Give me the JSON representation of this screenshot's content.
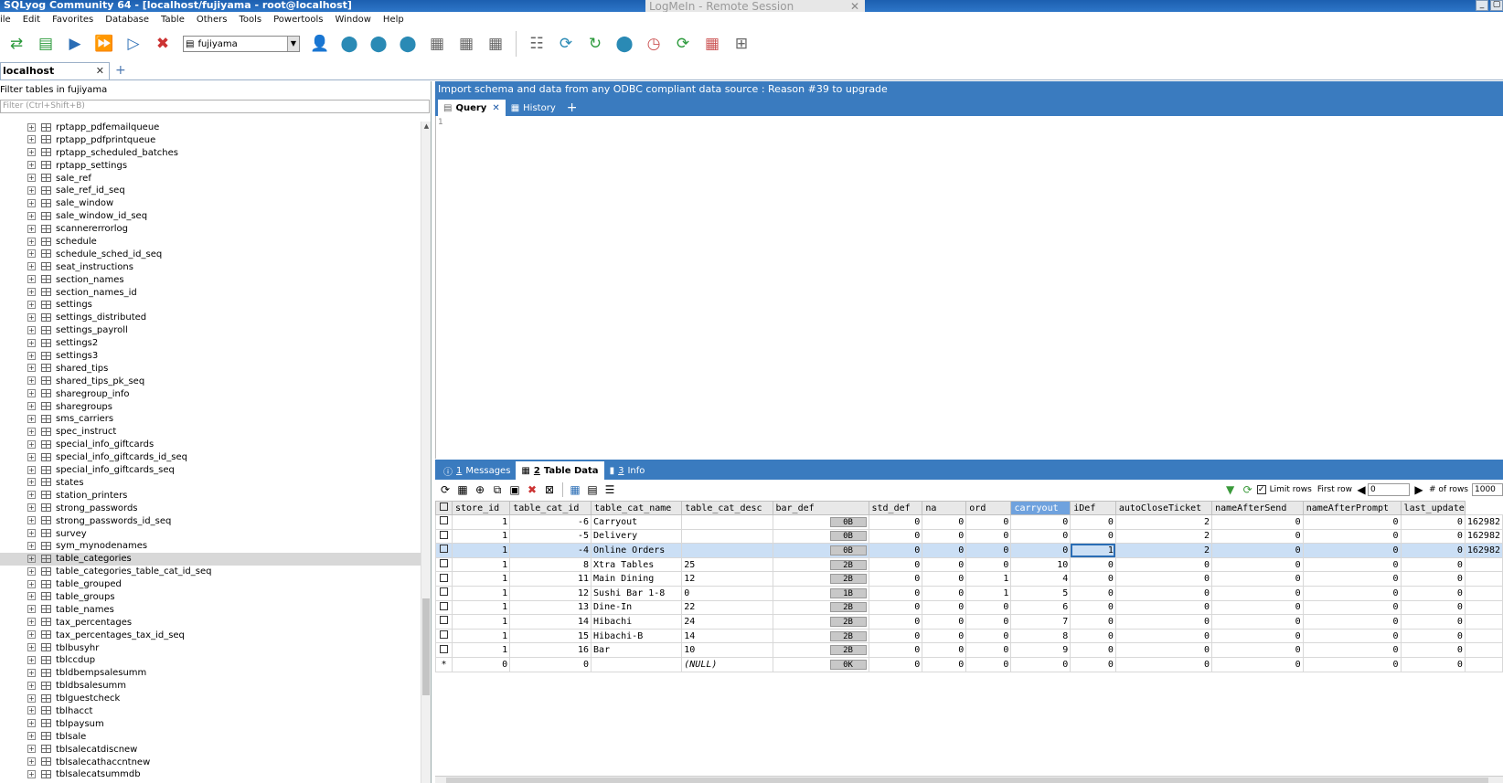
{
  "titlebar": {
    "title": "SQLyog Community 64 - [localhost/fujiyama - root@localhost]"
  },
  "overlay": {
    "text": "LogMeIn - Remote Session",
    "close": "✕"
  },
  "window_buttons": [
    "_",
    "▢"
  ],
  "menu": [
    "ile",
    "Edit",
    "Favorites",
    "Database",
    "Table",
    "Others",
    "Tools",
    "Powertools",
    "Window",
    "Help"
  ],
  "toolbar": {
    "icons": [
      "connect-icon",
      "new-query-icon",
      "execute-icon",
      "execute-all-icon",
      "execute-current-icon",
      "stop-icon"
    ],
    "glyphs": [
      "⇄",
      "▤",
      "▶",
      "⏩",
      "▷",
      "✖"
    ],
    "db_selected": "fujiyama",
    "right_glyphs": [
      "👤",
      "⬤",
      "⬤",
      "⬤",
      "▦",
      "▦",
      "▦",
      "☷",
      "⟳",
      "↻",
      "⬤",
      "◷",
      "⟳",
      "▦",
      "⊞"
    ]
  },
  "connection_tab": {
    "label": "localhost",
    "close": "✕",
    "add": "+"
  },
  "left": {
    "filter_label": "Filter tables in fujiyama",
    "filter_placeholder": "Filter (Ctrl+Shift+B)",
    "tables": [
      "rptapp_pdfemailqueue",
      "rptapp_pdfprintqueue",
      "rptapp_scheduled_batches",
      "rptapp_settings",
      "sale_ref",
      "sale_ref_id_seq",
      "sale_window",
      "sale_window_id_seq",
      "scannererrorlog",
      "schedule",
      "schedule_sched_id_seq",
      "seat_instructions",
      "section_names",
      "section_names_id",
      "settings",
      "settings_distributed",
      "settings_payroll",
      "settings2",
      "settings3",
      "shared_tips",
      "shared_tips_pk_seq",
      "sharegroup_info",
      "sharegroups",
      "sms_carriers",
      "spec_instruct",
      "special_info_giftcards",
      "special_info_giftcards_id_seq",
      "special_info_giftcards_seq",
      "states",
      "station_printers",
      "strong_passwords",
      "strong_passwords_id_seq",
      "survey",
      "sym_mynodenames",
      "table_categories",
      "table_categories_table_cat_id_seq",
      "table_grouped",
      "table_groups",
      "table_names",
      "tax_percentages",
      "tax_percentages_tax_id_seq",
      "tblbusyhr",
      "tblccdup",
      "tbldbempsalesumm",
      "tbldbsalesumm",
      "tblguestcheck",
      "tblhacct",
      "tblpaysum",
      "tblsale",
      "tblsalecatdiscnew",
      "tblsalecathaccntnew",
      "tblsalecatsummdb"
    ],
    "selected_index": 34
  },
  "banner": "Import schema and data from any ODBC compliant data source : Reason #39 to upgrade",
  "query_tabs": {
    "query": "Query",
    "close": "✕",
    "history": "History",
    "add": "+"
  },
  "editor": {
    "line": "1"
  },
  "result_tabs": [
    {
      "num": "1",
      "label": "Messages"
    },
    {
      "num": "2",
      "label": "Table Data"
    },
    {
      "num": "3",
      "label": "Info"
    }
  ],
  "grid_toolbar": {
    "limit_rows": "Limit rows",
    "first_row": "First row",
    "first_row_value": "0",
    "num_rows": "# of rows",
    "num_rows_value": "1000"
  },
  "grid": {
    "columns": [
      "store_id",
      "table_cat_id",
      "table_cat_name",
      "table_cat_desc",
      "bar_def",
      "std_def",
      "na",
      "ord",
      "carryout",
      "iDef",
      "autoCloseTicket",
      "nameAfterSend",
      "nameAfterPrompt",
      "last_update"
    ],
    "highlight_column": "carryout",
    "rows": [
      [
        "1",
        "-6",
        "Carryout",
        "",
        "0B",
        "0",
        "0",
        "0",
        "0",
        "0",
        "2",
        "0",
        "0",
        "0",
        "162982"
      ],
      [
        "1",
        "-5",
        "Delivery",
        "",
        "0B",
        "0",
        "0",
        "0",
        "0",
        "0",
        "2",
        "0",
        "0",
        "0",
        "162982"
      ],
      [
        "1",
        "-4",
        "Online Orders",
        "",
        "0B",
        "0",
        "0",
        "0",
        "0",
        "1",
        "2",
        "0",
        "0",
        "0",
        "162982"
      ],
      [
        "1",
        "8",
        "Xtra Tables",
        "25",
        "2B",
        "0",
        "0",
        "0",
        "10",
        "0",
        "0",
        "0",
        "0",
        "0",
        ""
      ],
      [
        "1",
        "11",
        "Main Dining",
        "12",
        "2B",
        "0",
        "0",
        "1",
        "4",
        "0",
        "0",
        "0",
        "0",
        "0",
        ""
      ],
      [
        "1",
        "12",
        "Sushi Bar 1-8",
        "0",
        "1B",
        "0",
        "0",
        "1",
        "5",
        "0",
        "0",
        "0",
        "0",
        "0",
        ""
      ],
      [
        "1",
        "13",
        "Dine-In",
        "22",
        "2B",
        "0",
        "0",
        "0",
        "6",
        "0",
        "0",
        "0",
        "0",
        "0",
        ""
      ],
      [
        "1",
        "14",
        "Hibachi",
        "24",
        "2B",
        "0",
        "0",
        "0",
        "7",
        "0",
        "0",
        "0",
        "0",
        "0",
        ""
      ],
      [
        "1",
        "15",
        "Hibachi-B",
        "14",
        "2B",
        "0",
        "0",
        "0",
        "8",
        "0",
        "0",
        "0",
        "0",
        "0",
        ""
      ],
      [
        "1",
        "16",
        "Bar",
        "10",
        "2B",
        "0",
        "0",
        "0",
        "9",
        "0",
        "0",
        "0",
        "0",
        "0",
        ""
      ],
      [
        "0",
        "0",
        "",
        "(NULL)",
        "0K",
        "0",
        "0",
        "0",
        "0",
        "0",
        "0",
        "0",
        "0",
        "0",
        ""
      ]
    ],
    "selected_row": 2,
    "new_row_marker": "*"
  }
}
